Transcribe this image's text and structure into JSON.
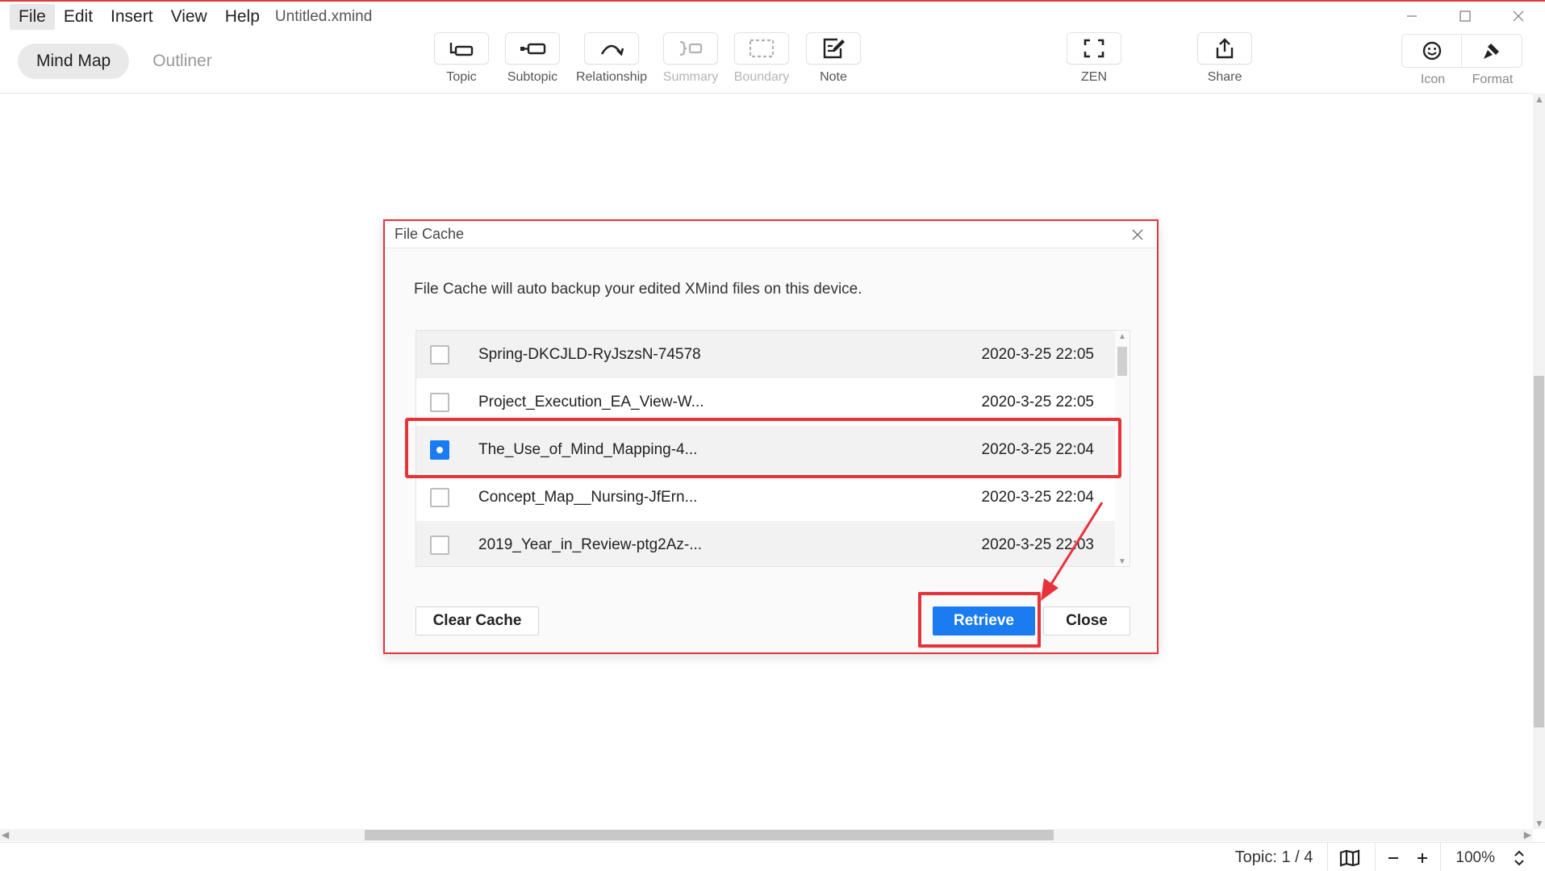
{
  "menubar": {
    "items": [
      "File",
      "Edit",
      "Insert",
      "View",
      "Help"
    ],
    "document_title": "Untitled.xmind"
  },
  "mode_tabs": [
    "Mind Map",
    "Outliner"
  ],
  "toolbar": {
    "topic": "Topic",
    "subtopic": "Subtopic",
    "relationship": "Relationship",
    "summary": "Summary",
    "boundary": "Boundary",
    "note": "Note",
    "zen": "ZEN",
    "share": "Share",
    "icon": "Icon",
    "format": "Format"
  },
  "dialog": {
    "title": "File Cache",
    "description": "File Cache will auto backup your edited XMind files on this device.",
    "files": [
      {
        "name": "Spring-DKCJLD-RyJszsN-74578",
        "date": "2020-3-25 22:05",
        "checked": false
      },
      {
        "name": "Project_Execution_EA_View-W...",
        "date": "2020-3-25 22:05",
        "checked": false
      },
      {
        "name": "The_Use_of_Mind_Mapping-4...",
        "date": "2020-3-25 22:04",
        "checked": true
      },
      {
        "name": "Concept_Map__Nursing-JfErn...",
        "date": "2020-3-25 22:04",
        "checked": false
      },
      {
        "name": "2019_Year_in_Review-ptg2Az-...",
        "date": "2020-3-25 22:03",
        "checked": false
      }
    ],
    "buttons": {
      "clear_cache": "Clear Cache",
      "retrieve": "Retrieve",
      "close": "Close"
    }
  },
  "statusbar": {
    "topic_count": "Topic: 1 / 4",
    "zoom": "100%"
  },
  "colors": {
    "accent": "#1a7cf0",
    "annotation_red": "#e8323a"
  }
}
